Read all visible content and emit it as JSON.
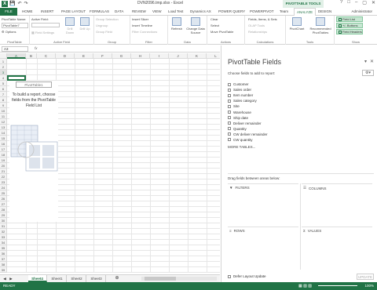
{
  "window": {
    "title": "DVN2096.tmp.xlsx - Excel",
    "context_label": "PIVOTTABLE TOOLS",
    "user": "Administrator"
  },
  "tabs": [
    "FILE",
    "HOME",
    "INSERT",
    "PAGE LAYOUT",
    "FORMULAS",
    "DATA",
    "REVIEW",
    "VIEW",
    "Load Test",
    "Dynamics AX",
    "POWER QUERY",
    "POWERPIVOT",
    "Team",
    "ANALYZE",
    "DESIGN"
  ],
  "active_tab": "ANALYZE",
  "ribbon": {
    "pivottable": {
      "name_label": "PivotTable Name:",
      "name_value": "PivotTable7",
      "options": "Options",
      "group": "PivotTable"
    },
    "active_field": {
      "label": "Active Field:",
      "field_settings": "Field Settings",
      "drill_down": "Drill Down",
      "drill_up": "Drill Up",
      "group": "Active Field"
    },
    "group_grp": {
      "group_selection": "Group Selection",
      "ungroup": "Ungroup",
      "group_field": "Group Field",
      "group": "Group"
    },
    "filter": {
      "insert_slicer": "Insert Slicer",
      "insert_timeline": "Insert Timeline",
      "filter_connections": "Filter Connections",
      "group": "Filter"
    },
    "data": {
      "refresh": "Refresh",
      "change_data_source": "Change Data Source",
      "group": "Data"
    },
    "actions": {
      "clear": "Clear",
      "select": "Select",
      "move": "Move PivotTable",
      "group": "Actions"
    },
    "calculations": {
      "fields_items_sets": "Fields, Items, & Sets",
      "olap_tools": "OLAP Tools",
      "relationships": "Relationships",
      "group": "Calculations"
    },
    "tools": {
      "pivotchart": "PivotChart",
      "recommended": "Recommended PivotTables",
      "group": "Tools"
    },
    "show": {
      "field_list": "Field List",
      "buttons": "+/- Buttons",
      "field_headers": "Field Headers",
      "group": "Show"
    }
  },
  "formula_bar": {
    "name_box": "A3",
    "fx": "fx"
  },
  "grid": {
    "columns": [
      "A",
      "B",
      "C",
      "D",
      "E",
      "F",
      "G",
      "H",
      "I",
      "J",
      "K",
      "L"
    ],
    "rows": [
      "1",
      "2",
      "3",
      "4",
      "5",
      "6",
      "7",
      "8",
      "9",
      "10",
      "11",
      "12",
      "13",
      "14",
      "15",
      "16",
      "17",
      "18",
      "19",
      "20",
      "21",
      "22",
      "23",
      "24",
      "25",
      "26",
      "27",
      "28",
      "29",
      "30",
      "31",
      "32",
      "33",
      "34",
      "35",
      "36",
      "37",
      "38",
      "39"
    ],
    "pivot_name": "PivotTable1",
    "pivot_message": "To build a report, choose fields from the PivotTable Field List"
  },
  "sheets": [
    "Sheet4",
    "Sheet1",
    "Sheet2",
    "Sheet3"
  ],
  "active_sheet": "Sheet4",
  "status": {
    "ready": "READY",
    "zoom": "100%"
  },
  "panel": {
    "title": "PivotTable Fields",
    "subtitle": "Choose fields to add to report:",
    "fields": [
      "Customer",
      "Sales order",
      "Item number",
      "Sales category",
      "Site",
      "Warehouse",
      "Ship date",
      "Deliver remainder",
      "Quantity",
      "CW deliver remainder",
      "CW quantity"
    ],
    "more_tables": "MORE TABLES...",
    "drag_label": "Drag fields between areas below:",
    "areas": {
      "filters": "FILTERS",
      "columns": "COLUMNS",
      "rows": "ROWS",
      "values": "VALUES"
    },
    "defer": "Defer Layout Update",
    "update": "UPDATE"
  }
}
